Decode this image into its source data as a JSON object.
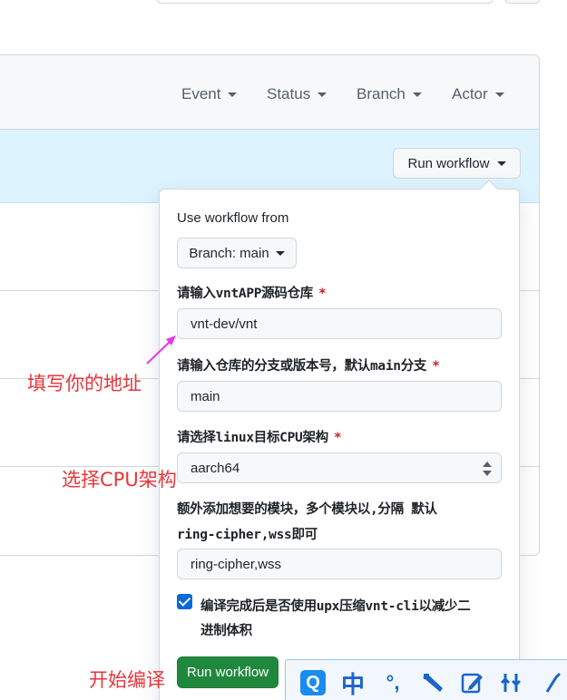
{
  "filters": [
    {
      "label": "Event"
    },
    {
      "label": "Status"
    },
    {
      "label": "Branch"
    },
    {
      "label": "Actor"
    }
  ],
  "run_workflow_toggle": {
    "label": "Run workflow"
  },
  "popover": {
    "title": "Use workflow from",
    "branch_button": "Branch: main",
    "fields": [
      {
        "label": "请输入vntAPP源码仓库",
        "required": "*",
        "value": "vnt-dev/vnt"
      },
      {
        "label": "请输入仓库的分支或版本号，默认main分支",
        "required": "*",
        "value": "main"
      },
      {
        "label": "请选择linux目标CPU架构",
        "required": "*",
        "value": "aarch64"
      },
      {
        "label_line1": "额外添加想要的模块，多个模块以,分隔 默认",
        "label_line2": "ring-cipher,wss即可",
        "value": "ring-cipher,wss"
      }
    ],
    "checkbox": {
      "checked": true,
      "label_line1": "编译完成后是否使用upx压缩vnt-cli以减少二",
      "label_line2": "进制体积"
    },
    "run_button": "Run workflow"
  },
  "annotations": {
    "fill_address": "填写你的地址",
    "select_cpu": "选择CPU架构",
    "start_compile": "开始编译"
  },
  "ime_toolbar": {
    "q_logo": "Q",
    "mode": "中",
    "punct": "°,"
  },
  "colors": {
    "accent": "#0969da",
    "primary_button": "#1f883d",
    "banner": "#ddf4ff",
    "required": "#cf222e",
    "annotation": "#e8353a"
  }
}
